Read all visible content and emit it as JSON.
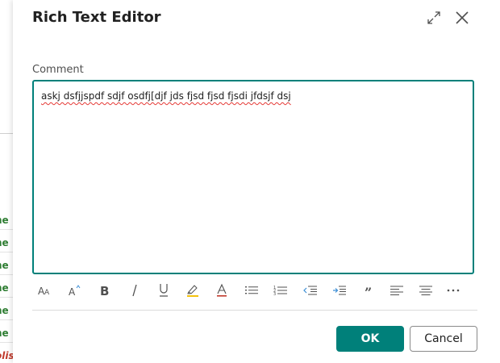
{
  "background": {
    "rows": [
      {
        "text": "he",
        "style": "green"
      },
      {
        "text": "he",
        "style": "green"
      },
      {
        "text": "he",
        "style": "green"
      },
      {
        "text": "he",
        "style": "green"
      },
      {
        "text": "he",
        "style": "green"
      },
      {
        "text": "he",
        "style": "green"
      },
      {
        "text": "olis",
        "style": "red"
      }
    ]
  },
  "dialog": {
    "title": "Rich Text Editor",
    "field_label": "Comment",
    "editor_text": "askj dsfjjspdf sdjf osdfj[djf jds fjsd fjsd fjsdi jfdsjf dsj",
    "toolbar": [
      "font-size-icon",
      "font-color-icon",
      "bold-icon",
      "italic-icon",
      "underline-icon",
      "highlight-icon",
      "text-color-icon",
      "bulleted-list-icon",
      "numbered-list-icon",
      "decrease-indent-icon",
      "increase-indent-icon",
      "quote-icon",
      "align-left-icon",
      "align-center-icon",
      "more-options-icon"
    ],
    "ok_label": "OK",
    "cancel_label": "Cancel"
  },
  "colors": {
    "accent": "#00807a",
    "spellcheck": "#e53935",
    "highlight": "#f4c20d",
    "text_color": "#c0392b"
  }
}
